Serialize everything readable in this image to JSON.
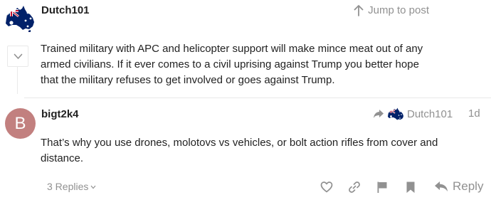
{
  "quoted_post": {
    "author": "Dutch101",
    "jump_label": "Jump to post",
    "body": "Trained military with APC and helicopter support will make mince meat out of any armed civilians. If it ever comes to a civil uprising against Trump you better hope that the military refuses to get involved or goes against Trump.",
    "avatar_icon": "australia-map-flag-icon"
  },
  "post": {
    "author": "bigt2k4",
    "avatar_letter": "B",
    "avatar_color": "#c2807f",
    "reply_to_user": "Dutch101",
    "date": "1d",
    "body": "That’s why you use drones, molotovs vs vehicles, or bolt action rifles from cover and distance."
  },
  "controls": {
    "replies_label": "3 Replies",
    "reply_label": "Reply",
    "icons": [
      "heart-icon",
      "link-icon",
      "flag-icon",
      "bookmark-icon",
      "reply-arrow-icon"
    ]
  },
  "colors": {
    "muted_text": "#919191",
    "body_text": "#222222",
    "divider": "#e9e9e9"
  }
}
